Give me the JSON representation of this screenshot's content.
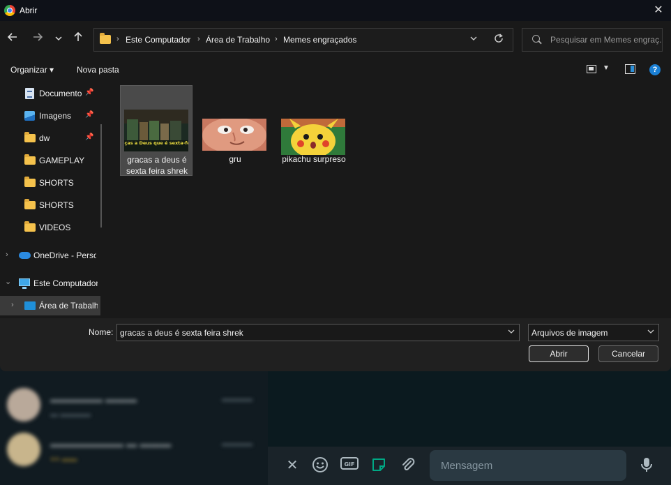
{
  "titlebar": {
    "title": "Abrir"
  },
  "breadcrumb": {
    "items": [
      "Este Computador",
      "Área de Trabalho",
      "Memes engraçados"
    ],
    "separator": "›"
  },
  "search": {
    "placeholder": "Pesquisar em Memes engraç..."
  },
  "toolbar": {
    "organize": "Organizar ▾",
    "new_folder": "Nova pasta",
    "help": "?"
  },
  "sidebar": {
    "items": [
      {
        "label": "Documento",
        "icon": "document-icon",
        "pinned": true
      },
      {
        "label": "Imagens",
        "icon": "pictures-icon",
        "pinned": true
      },
      {
        "label": "dw",
        "icon": "folder-icon",
        "pinned": true
      },
      {
        "label": "GAMEPLAY",
        "icon": "folder-icon",
        "pinned": false
      },
      {
        "label": "SHORTS",
        "icon": "folder-icon",
        "pinned": false
      },
      {
        "label": "SHORTS",
        "icon": "folder-icon",
        "pinned": false
      },
      {
        "label": "VIDEOS",
        "icon": "folder-icon",
        "pinned": false
      },
      {
        "label": "OneDrive - Perso",
        "icon": "onedrive-icon"
      },
      {
        "label": "Este Computador",
        "icon": "computer-icon"
      },
      {
        "label": "Área de Trabalh",
        "icon": "desktop-icon"
      }
    ]
  },
  "files": [
    {
      "name": "gracas a deus é sexta feira shrek",
      "thumb_caption": "Graças a Deus que é sexta-feira",
      "selected": true
    },
    {
      "name": "gru",
      "selected": false
    },
    {
      "name": "pikachu surpreso",
      "selected": false
    }
  ],
  "footer": {
    "name_label": "Nome:",
    "name_value": "gracas a deus é sexta feira shrek",
    "file_type": "Arquivos de imagem",
    "open_label": "Abrir",
    "cancel_label": "Cancelar"
  },
  "composer": {
    "placeholder": "Mensagem"
  },
  "colors": {
    "accent": "#1a7fd4",
    "folder": "#f5c24c",
    "sticker": "#00a884"
  }
}
